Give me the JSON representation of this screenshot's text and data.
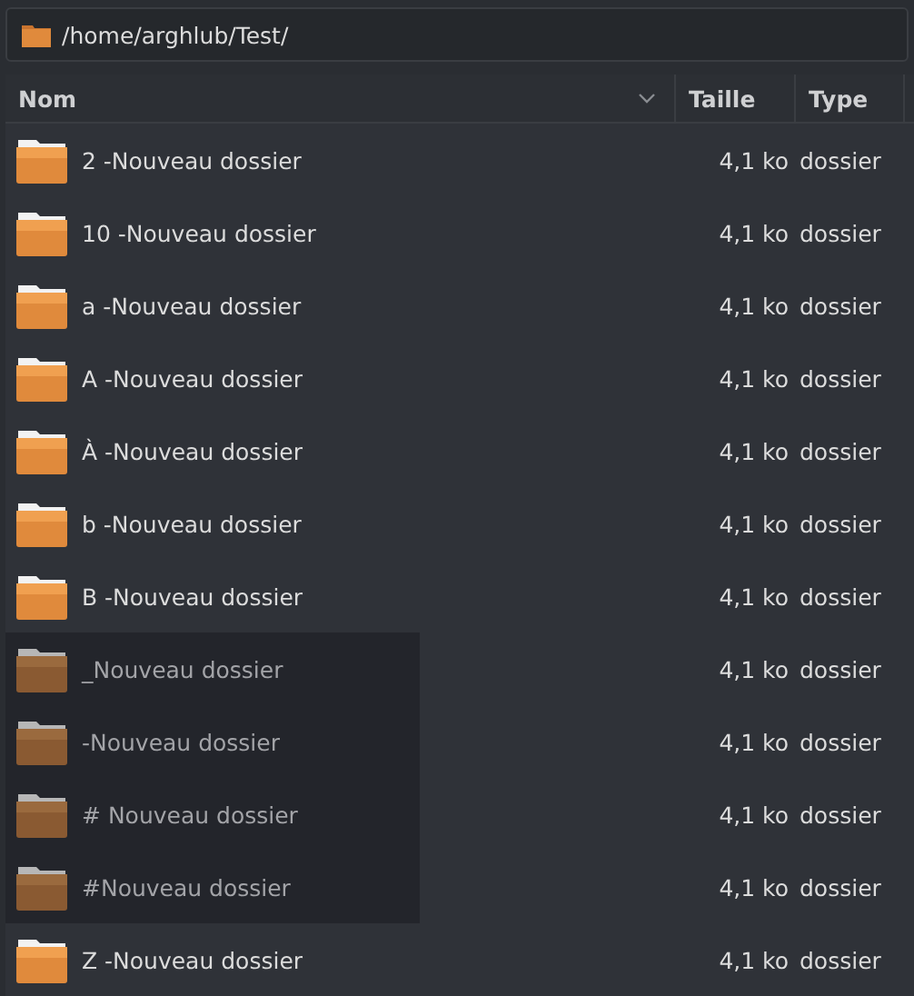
{
  "path_bar": {
    "path": "/home/arghlub/Test/"
  },
  "table": {
    "columns": [
      {
        "label": "Nom",
        "sort_caret": true
      },
      {
        "label": "Taille",
        "sort_caret": false
      },
      {
        "label": "Type",
        "sort_caret": false
      }
    ],
    "rows": [
      {
        "name": "2 -Nouveau dossier",
        "size": "4,1 ko",
        "type": "dossier",
        "dimmed": false
      },
      {
        "name": "10 -Nouveau dossier",
        "size": "4,1 ko",
        "type": "dossier",
        "dimmed": false
      },
      {
        "name": "a -Nouveau dossier",
        "size": "4,1 ko",
        "type": "dossier",
        "dimmed": false
      },
      {
        "name": "A -Nouveau dossier",
        "size": "4,1 ko",
        "type": "dossier",
        "dimmed": false
      },
      {
        "name": "À -Nouveau dossier",
        "size": "4,1 ko",
        "type": "dossier",
        "dimmed": false
      },
      {
        "name": "b -Nouveau dossier",
        "size": "4,1 ko",
        "type": "dossier",
        "dimmed": false
      },
      {
        "name": "B -Nouveau dossier",
        "size": "4,1 ko",
        "type": "dossier",
        "dimmed": false
      },
      {
        "name": "_Nouveau dossier",
        "size": "4,1 ko",
        "type": "dossier",
        "dimmed": true
      },
      {
        "name": "-Nouveau dossier",
        "size": "4,1 ko",
        "type": "dossier",
        "dimmed": true
      },
      {
        "name": "# Nouveau dossier",
        "size": "4,1 ko",
        "type": "dossier",
        "dimmed": true
      },
      {
        "name": "#Nouveau dossier",
        "size": "4,1 ko",
        "type": "dossier",
        "dimmed": true
      },
      {
        "name": "Z -Nouveau dossier",
        "size": "4,1 ko",
        "type": "dossier",
        "dimmed": false
      }
    ]
  }
}
